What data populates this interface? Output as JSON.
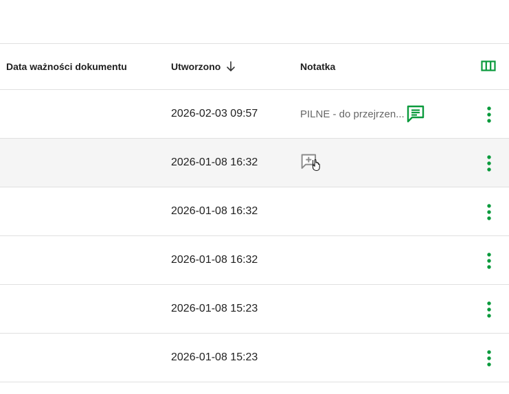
{
  "table": {
    "headers": {
      "expiry": "Data ważności dokumentu",
      "created": "Utworzono",
      "note": "Notatka"
    },
    "sort": {
      "column": "created",
      "direction": "descending"
    },
    "rows": [
      {
        "created": "2026-02-03 09:57",
        "note": "PILNE - do przejrzen..."
      },
      {
        "created": "2026-01-08 16:32",
        "note": ""
      },
      {
        "created": "2026-01-08 16:32",
        "note": ""
      },
      {
        "created": "2026-01-08 16:32",
        "note": ""
      },
      {
        "created": "2026-01-08 15:23",
        "note": ""
      },
      {
        "created": "2026-01-08 15:23",
        "note": ""
      }
    ]
  },
  "icons": {
    "sort": "arrow-down-icon",
    "columns": "view-columns-icon",
    "note": "comment-icon",
    "add_note": "add-comment-icon",
    "menu": "more-vertical-icon"
  },
  "colors": {
    "accent": "#0a9a3c",
    "hover_row": "#f5f5f5",
    "divider": "#e0e0e0"
  }
}
